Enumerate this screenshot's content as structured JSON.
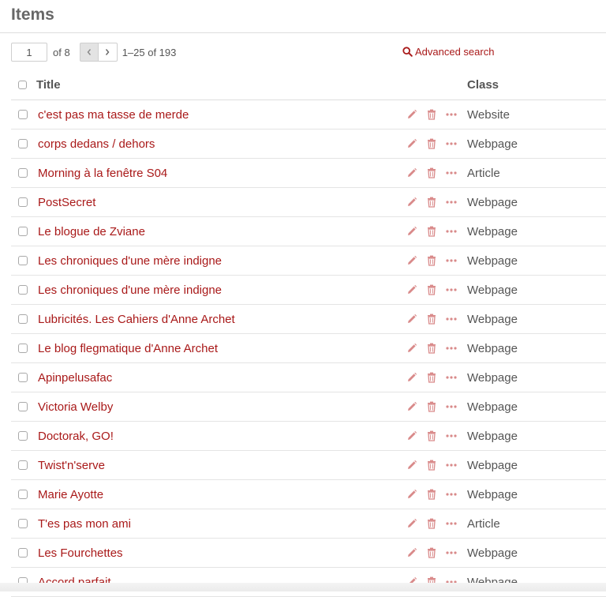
{
  "page": {
    "title": "Items"
  },
  "pagination": {
    "current_page": "1",
    "of_pages": "of 8",
    "prev_icon": "chevron-left-icon",
    "next_icon": "chevron-right-icon",
    "range": "1–25 of 193"
  },
  "advanced_search": {
    "label": "Advanced search",
    "icon": "search-icon"
  },
  "colors": {
    "link": "#a91919",
    "text": "#555555",
    "icon": "#d98a8a"
  },
  "table": {
    "headers": {
      "title": "Title",
      "class": "Class"
    },
    "row_actions": [
      "pencil-icon",
      "trash-icon",
      "ellipsis-icon"
    ],
    "rows": [
      {
        "title": "c'est pas ma tasse de merde",
        "class": "Website"
      },
      {
        "title": "corps dedans / dehors",
        "class": "Webpage"
      },
      {
        "title": "Morning à la fenêtre S04",
        "class": "Article"
      },
      {
        "title": "PostSecret",
        "class": "Webpage"
      },
      {
        "title": "Le blogue de Zviane",
        "class": "Webpage"
      },
      {
        "title": "Les chroniques d'une mère indigne",
        "class": "Webpage"
      },
      {
        "title": "Les chroniques d'une mère indigne",
        "class": "Webpage"
      },
      {
        "title": "Lubricités. Les Cahiers d'Anne Archet",
        "class": "Webpage"
      },
      {
        "title": "Le blog flegmatique d'Anne Archet",
        "class": "Webpage"
      },
      {
        "title": "Apinpelusafac",
        "class": "Webpage"
      },
      {
        "title": "Victoria Welby",
        "class": "Webpage"
      },
      {
        "title": "Doctorak, GO!",
        "class": "Webpage"
      },
      {
        "title": "Twist'n'serve",
        "class": "Webpage"
      },
      {
        "title": "Marie Ayotte",
        "class": "Webpage"
      },
      {
        "title": "T'es pas mon ami",
        "class": "Article"
      },
      {
        "title": "Les Fourchettes",
        "class": "Webpage"
      },
      {
        "title": "Accord parfait",
        "class": "Webpage"
      }
    ]
  }
}
